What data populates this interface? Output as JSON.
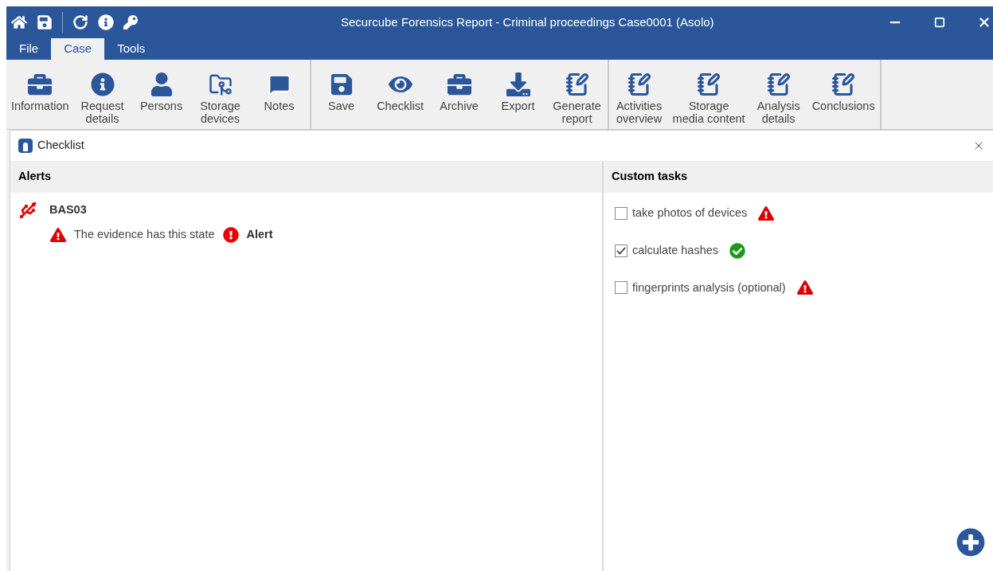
{
  "window": {
    "title": "Securcube Forensics Report - Criminal proceedings Case0001 (Asolo)"
  },
  "tabs": [
    {
      "label": "File",
      "selected": false
    },
    {
      "label": "Case",
      "selected": true
    },
    {
      "label": "Tools",
      "selected": false
    }
  ],
  "ribbon": {
    "groups": [
      {
        "items": [
          {
            "lines": [
              "Information"
            ]
          },
          {
            "lines": [
              "Request",
              "details"
            ]
          },
          {
            "lines": [
              "Persons"
            ]
          },
          {
            "lines": [
              "Storage",
              "devices"
            ]
          },
          {
            "lines": [
              "Notes"
            ]
          }
        ]
      },
      {
        "items": [
          {
            "lines": [
              "Save"
            ]
          },
          {
            "lines": [
              "Checklist"
            ]
          },
          {
            "lines": [
              "Archive"
            ]
          },
          {
            "lines": [
              "Export"
            ]
          },
          {
            "lines": [
              "Generate",
              "report"
            ]
          }
        ]
      },
      {
        "items": [
          {
            "lines": [
              "Activities",
              "overview"
            ]
          },
          {
            "lines": [
              "Storage",
              "media content"
            ]
          },
          {
            "lines": [
              "Analysis",
              "details"
            ]
          },
          {
            "lines": [
              "Conclusions"
            ]
          }
        ]
      }
    ]
  },
  "panel": {
    "title": "Checklist",
    "alerts": {
      "heading": "Alerts",
      "items": [
        {
          "device": "BAS03",
          "message": "The evidence has this state",
          "state": "Alert"
        }
      ]
    },
    "custom_tasks": {
      "heading": "Custom tasks",
      "items": [
        {
          "label": "take photos of devices",
          "checked": false
        },
        {
          "label": "calculate hashes",
          "checked": true
        },
        {
          "label": "fingerprints analysis (optional)",
          "checked": false
        }
      ]
    }
  }
}
